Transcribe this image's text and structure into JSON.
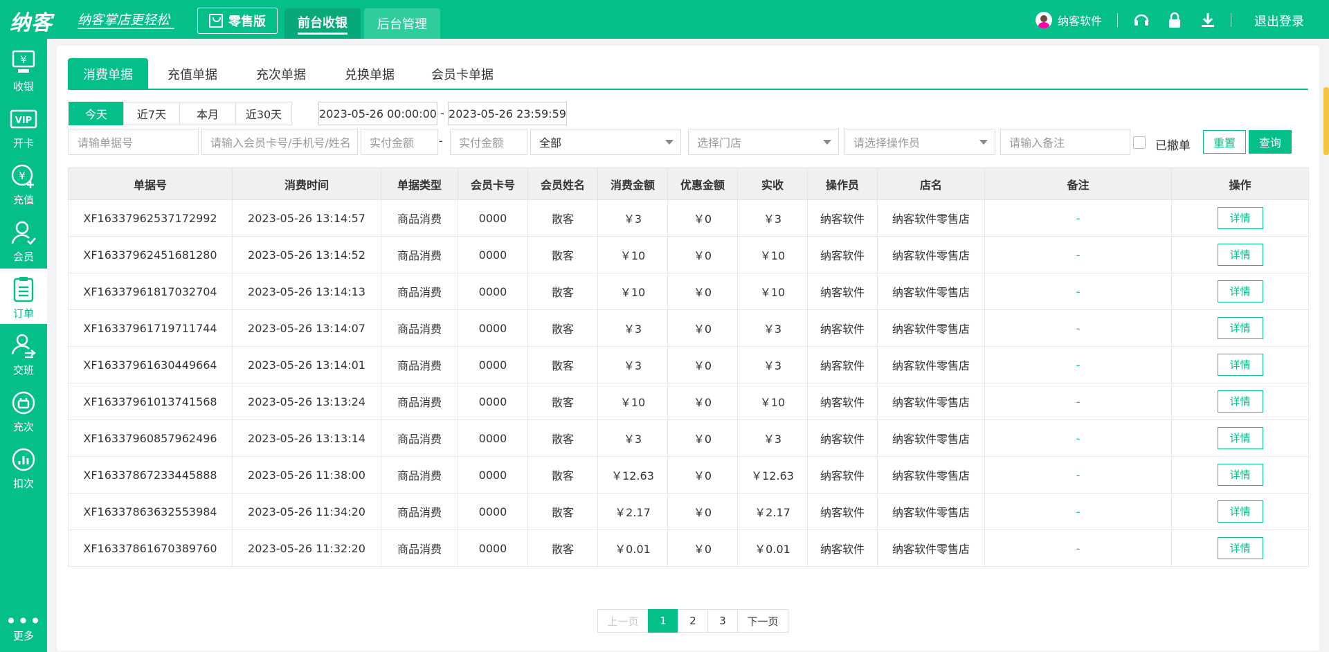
{
  "header": {
    "logo": "纳客",
    "slogan": "纳客掌店更轻松",
    "edition": "零售版",
    "tabs": [
      "前台收银",
      "后台管理"
    ],
    "user_name": "纳客软件",
    "logout": "退出登录"
  },
  "sidebar": {
    "items": [
      {
        "label": "收银",
        "icon": "cashier-icon"
      },
      {
        "label": "开卡",
        "icon": "vip-card-icon"
      },
      {
        "label": "充值",
        "icon": "recharge-icon"
      },
      {
        "label": "会员",
        "icon": "member-icon"
      },
      {
        "label": "订单",
        "icon": "order-icon"
      },
      {
        "label": "交班",
        "icon": "shift-icon"
      },
      {
        "label": "充次",
        "icon": "recharge-times-icon"
      },
      {
        "label": "扣次",
        "icon": "deduct-times-icon"
      }
    ],
    "more": "更多"
  },
  "tabs": [
    "消费单据",
    "充值单据",
    "充次单据",
    "兑换单据",
    "会员卡单据"
  ],
  "filters": {
    "quick": [
      "今天",
      "近7天",
      "本月",
      "近30天"
    ],
    "date_start": "2023-05-26 00:00:00",
    "date_end": "2023-05-26 23:59:59",
    "dash": "-",
    "order_no_placeholder": "请输单据号",
    "member_placeholder": "请输入会员卡号/手机号/姓名",
    "amount_min_placeholder": "实付金额",
    "amount_max_placeholder": "实付金额",
    "type_value": "全部",
    "store_placeholder": "选择门店",
    "operator_placeholder": "请选择操作员",
    "note_placeholder": "请输入备注",
    "revoked_label": "已撤单",
    "reset": "重置",
    "query": "查询"
  },
  "table": {
    "columns": [
      "单据号",
      "消费时间",
      "单据类型",
      "会员卡号",
      "会员姓名",
      "消费金额",
      "优惠金额",
      "实收",
      "操作员",
      "店名",
      "备注",
      "操作"
    ],
    "action_label": "详情",
    "rows": [
      [
        "XF16337962537172992",
        "2023-05-26 13:14:57",
        "商品消费",
        "0000",
        "散客",
        "￥3",
        "￥0",
        "￥3",
        "纳客软件",
        "纳客软件零售店",
        "-"
      ],
      [
        "XF16337962451681280",
        "2023-05-26 13:14:52",
        "商品消费",
        "0000",
        "散客",
        "￥10",
        "￥0",
        "￥10",
        "纳客软件",
        "纳客软件零售店",
        "-"
      ],
      [
        "XF16337961817032704",
        "2023-05-26 13:14:13",
        "商品消费",
        "0000",
        "散客",
        "￥10",
        "￥0",
        "￥10",
        "纳客软件",
        "纳客软件零售店",
        "-"
      ],
      [
        "XF16337961719711744",
        "2023-05-26 13:14:07",
        "商品消费",
        "0000",
        "散客",
        "￥3",
        "￥0",
        "￥3",
        "纳客软件",
        "纳客软件零售店",
        "-"
      ],
      [
        "XF16337961630449664",
        "2023-05-26 13:14:01",
        "商品消费",
        "0000",
        "散客",
        "￥3",
        "￥0",
        "￥3",
        "纳客软件",
        "纳客软件零售店",
        "-"
      ],
      [
        "XF16337961013741568",
        "2023-05-26 13:13:24",
        "商品消费",
        "0000",
        "散客",
        "￥10",
        "￥0",
        "￥10",
        "纳客软件",
        "纳客软件零售店",
        "-"
      ],
      [
        "XF16337960857962496",
        "2023-05-26 13:13:14",
        "商品消费",
        "0000",
        "散客",
        "￥3",
        "￥0",
        "￥3",
        "纳客软件",
        "纳客软件零售店",
        "-"
      ],
      [
        "XF16337867233445888",
        "2023-05-26 11:38:00",
        "商品消费",
        "0000",
        "散客",
        "￥12.63",
        "￥0",
        "￥12.63",
        "纳客软件",
        "纳客软件零售店",
        "-"
      ],
      [
        "XF16337863632553984",
        "2023-05-26 11:34:20",
        "商品消费",
        "0000",
        "散客",
        "￥2.17",
        "￥0",
        "￥2.17",
        "纳客软件",
        "纳客软件零售店",
        "-"
      ],
      [
        "XF16337861670389760",
        "2023-05-26 11:32:20",
        "商品消费",
        "0000",
        "散客",
        "￥0.01",
        "￥0",
        "￥0.01",
        "纳客软件",
        "纳客软件零售店",
        "-"
      ]
    ]
  },
  "pagination": {
    "prev": "上一页",
    "pages": [
      "1",
      "2",
      "3"
    ],
    "current": "1",
    "next": "下一页"
  },
  "colors": {
    "brand": "#05bf8a",
    "header_bg": "#eef0f2"
  }
}
